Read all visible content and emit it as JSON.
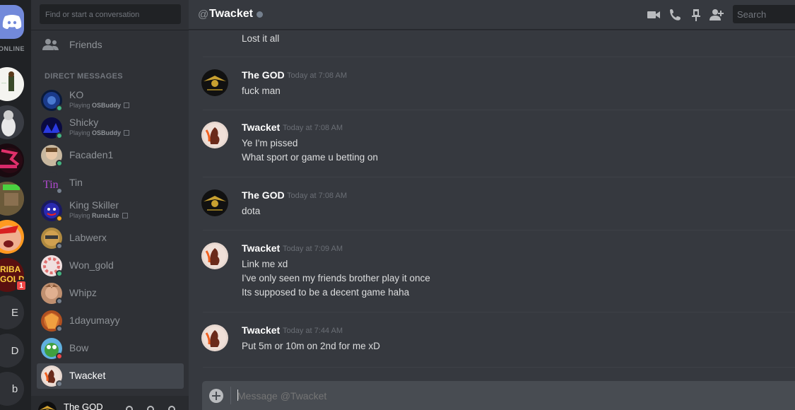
{
  "guilds": {
    "online_label": "ONLINE",
    "letters": [
      "E",
      "D",
      "b"
    ],
    "badge_count": "1",
    "guild_texts": [
      "RIBA",
      "GOLD"
    ]
  },
  "dm_list": {
    "search_placeholder": "Find or start a conversation",
    "friends_label": "Friends",
    "header": "DIRECT MESSAGES",
    "items": [
      {
        "name": "KO",
        "status": "online",
        "activity_prefix": "Playing ",
        "activity": "OSBuddy"
      },
      {
        "name": "Shicky",
        "status": "online",
        "activity_prefix": "Playing ",
        "activity": "OSBuddy"
      },
      {
        "name": "Facaden1",
        "status": "online"
      },
      {
        "name": "Tin",
        "status": "offline"
      },
      {
        "name": "King Skiller",
        "status": "idle",
        "activity_prefix": "Playing ",
        "activity": "RuneLite"
      },
      {
        "name": "Labwerx",
        "status": "offline"
      },
      {
        "name": "Won_gold",
        "status": "online"
      },
      {
        "name": "Whipz",
        "status": "offline"
      },
      {
        "name": "1dayumayy",
        "status": "offline"
      },
      {
        "name": "Bow",
        "status": "dnd"
      },
      {
        "name": "Twacket",
        "status": "offline",
        "active": true
      }
    ],
    "current_user": "The GOD"
  },
  "chat": {
    "at_symbol": "@",
    "channel_name": "Twacket",
    "search_placeholder": "Search",
    "messages": [
      {
        "lines": [
          "Lost it all"
        ]
      },
      {
        "author": "The GOD",
        "time": "Today at 7:08 AM",
        "lines": [
          "fuck man"
        ]
      },
      {
        "author": "Twacket",
        "time": "Today at 7:08 AM",
        "lines": [
          "Ye I'm pissed",
          "What sport or game u betting on"
        ]
      },
      {
        "author": "The GOD",
        "time": "Today at 7:08 AM",
        "lines": [
          "dota"
        ]
      },
      {
        "author": "Twacket",
        "time": "Today at 7:09 AM",
        "lines": [
          "Link me xd",
          "I've only seen my friends brother play it once",
          "Its supposed to be a decent game haha"
        ]
      },
      {
        "author": "Twacket",
        "time": "Today at 7:44 AM",
        "lines": [
          "Put 5m or 10m on 2nd for me xD"
        ]
      }
    ],
    "composer_placeholder": "Message @Twacket"
  },
  "colors": {
    "blurple": "#7289da",
    "online": "#43b581",
    "idle": "#faa61a",
    "dnd": "#f04747",
    "offline": "#747f8d"
  }
}
